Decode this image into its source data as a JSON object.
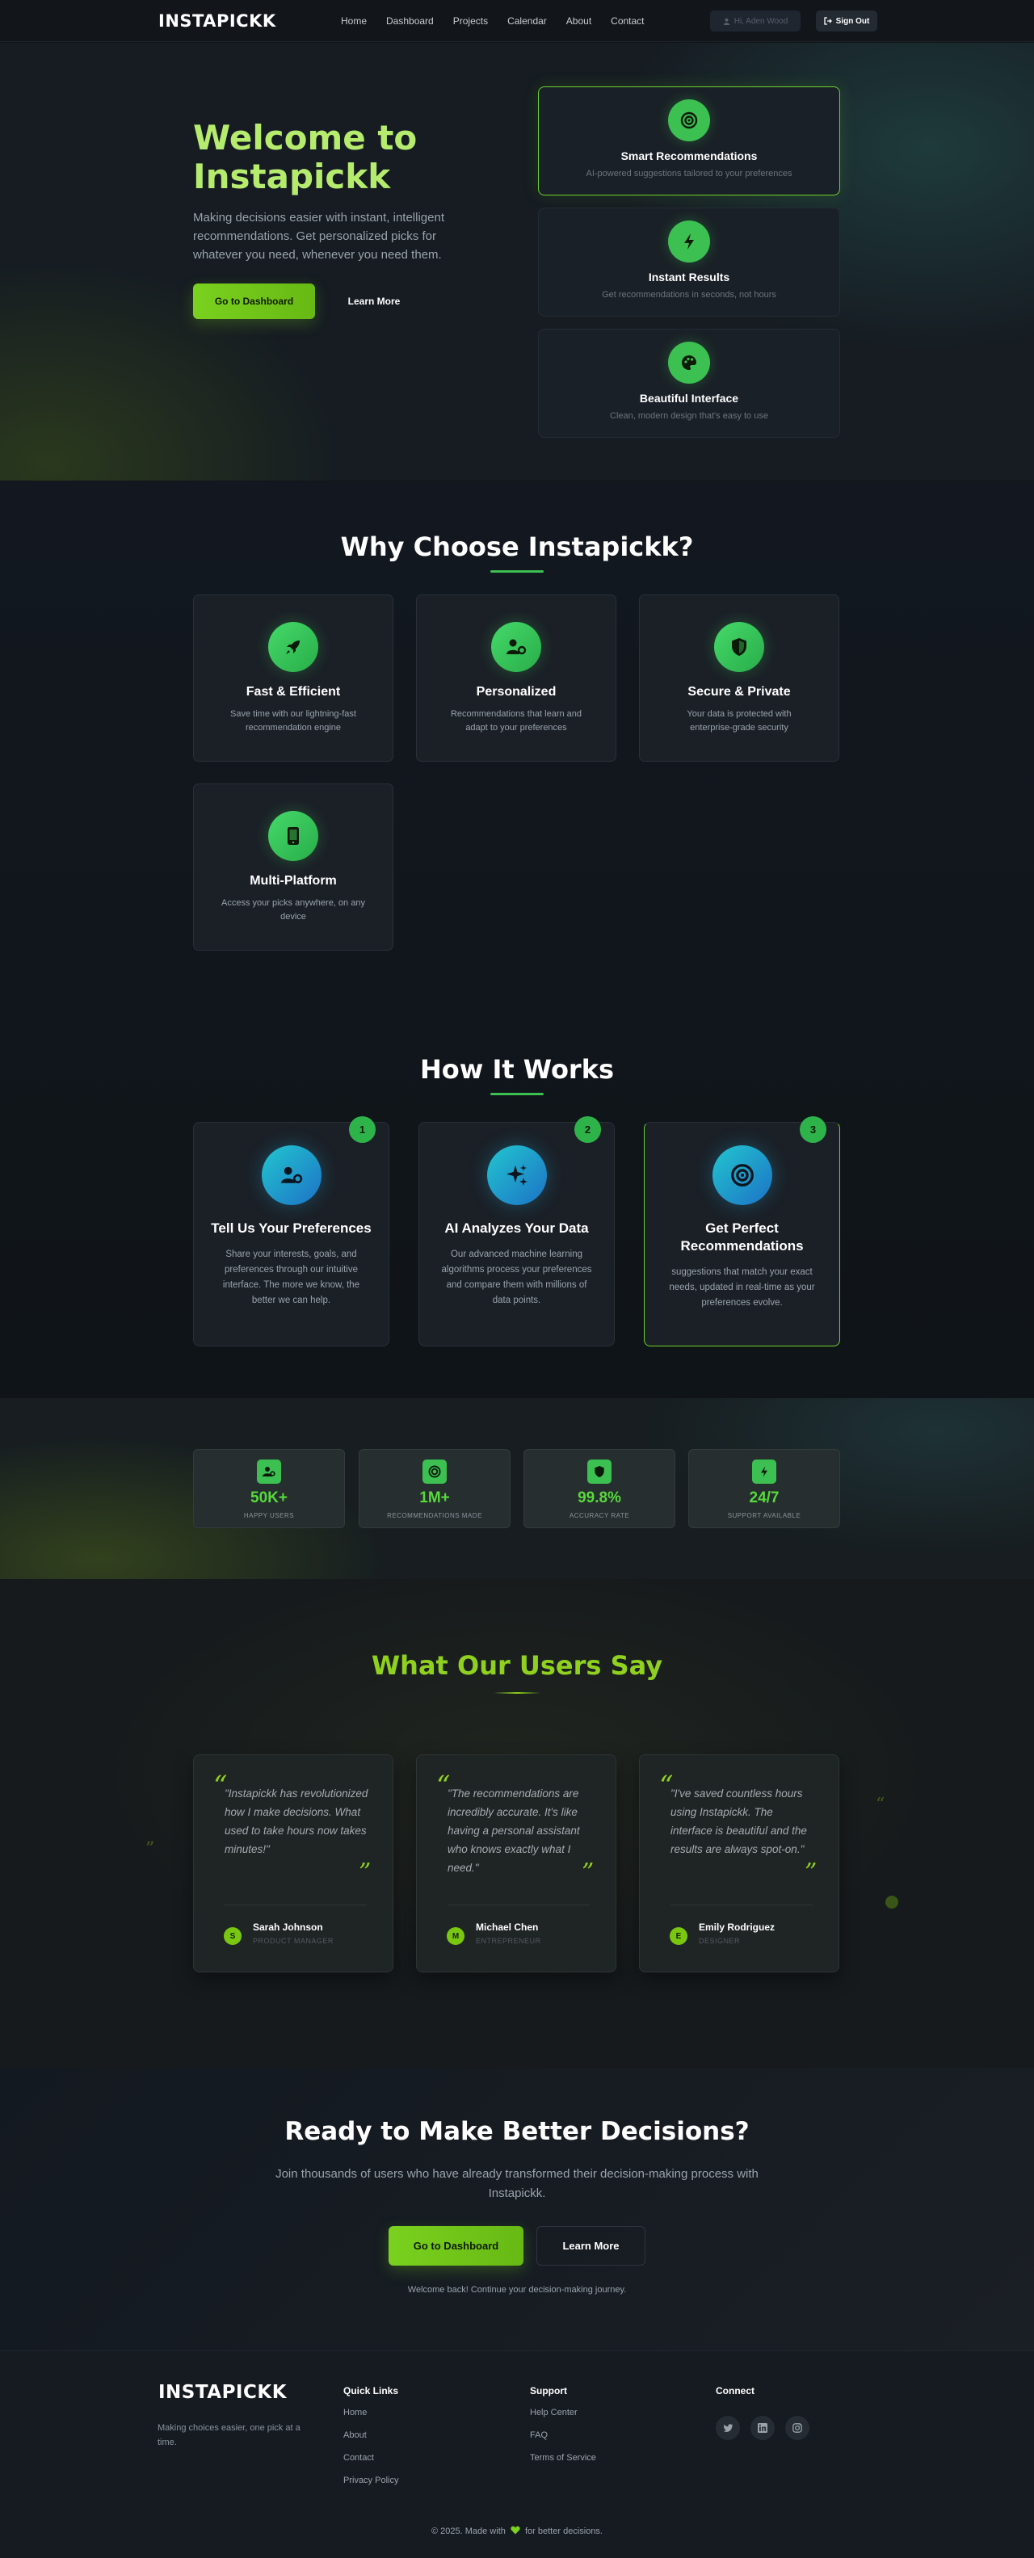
{
  "brand": {
    "name": "INSTAPICKK",
    "accent": "#7ad11e",
    "green": "#3cc052",
    "blue": "#1d72c6"
  },
  "nav": {
    "links": [
      "Home",
      "Dashboard",
      "Projects",
      "Calendar",
      "About",
      "Contact"
    ],
    "user": "Hi, Aden Wood",
    "signout": "Sign Out"
  },
  "hero": {
    "title": "Welcome to Instapickk",
    "subtitle": "Making decisions easier with instant, intelligent recommendations. Get personalized picks for whatever you need, whenever you need them.",
    "primary_button": "Go to Dashboard",
    "secondary_button": "Learn More",
    "features": [
      {
        "icon": "target-icon",
        "title": "Smart Recommendations",
        "desc": "AI-powered suggestions tailored to your preferences"
      },
      {
        "icon": "bolt-icon",
        "title": "Instant Results",
        "desc": "Get recommendations in seconds, not hours"
      },
      {
        "icon": "palette-icon",
        "title": "Beautiful Interface",
        "desc": "Clean, modern design that's easy to use"
      }
    ]
  },
  "why": {
    "title": "Why Choose Instapickk?",
    "cards": [
      {
        "icon": "rocket-icon",
        "title": "Fast & Efficient",
        "desc": "Save time with our lightning-fast recommendation engine"
      },
      {
        "icon": "user-gear-icon",
        "title": "Personalized",
        "desc": "Recommendations that learn and adapt to your preferences"
      },
      {
        "icon": "shield-icon",
        "title": "Secure & Private",
        "desc": "Your data is protected with enterprise-grade security"
      },
      {
        "icon": "mobile-icon",
        "title": "Multi-Platform",
        "desc": "Access your picks anywhere, on any device"
      }
    ]
  },
  "how": {
    "title": "How It Works",
    "steps": [
      {
        "num": "1",
        "icon": "user-gear-icon",
        "title": "Tell Us Your Preferences",
        "desc": "Share your interests, goals, and preferences through our intuitive interface. The more we know, the better we can help."
      },
      {
        "num": "2",
        "icon": "sparkles-icon",
        "title": "AI Analyzes Your Data",
        "desc": "Our advanced machine learning algorithms process your preferences and compare them with millions of data points."
      },
      {
        "num": "3",
        "icon": "target-icon",
        "title": "Get Perfect Recommendations",
        "desc": "suggestions that match your exact needs, updated in real-time as your preferences evolve."
      }
    ]
  },
  "stats": [
    {
      "icon": "users-icon",
      "value": "50K+",
      "label": "HAPPY USERS"
    },
    {
      "icon": "target-icon",
      "value": "1M+",
      "label": "RECOMMENDATIONS MADE"
    },
    {
      "icon": "shield-icon",
      "value": "99.8%",
      "label": "ACCURACY RATE"
    },
    {
      "icon": "bolt-icon",
      "value": "24/7",
      "label": "SUPPORT AVAILABLE"
    }
  ],
  "testimonials": {
    "title": "What Our Users Say",
    "items": [
      {
        "text": "Instapickk has revolutionized how I make decisions. What used to take hours now takes minutes!",
        "name": "Sarah Johnson",
        "role": "PRODUCT MANAGER",
        "initial": "S"
      },
      {
        "text": "The recommendations are incredibly accurate. It's like having a personal assistant who knows exactly what I need.",
        "name": "Michael Chen",
        "role": "ENTREPRENEUR",
        "initial": "M"
      },
      {
        "text": "I've saved countless hours using Instapickk. The interface is beautiful and the results are always spot-on.",
        "name": "Emily Rodriguez",
        "role": "DESIGNER",
        "initial": "E"
      }
    ]
  },
  "cta": {
    "title": "Ready to Make Better Decisions?",
    "subtitle": "Join thousands of users who have already transformed their decision-making process with Instapickk.",
    "primary_button": "Go to Dashboard",
    "secondary_button": "Learn More",
    "note": "Welcome back! Continue your decision-making journey."
  },
  "footer": {
    "logo": "INSTAPICKK",
    "tagline": "Making choices easier, one pick at a time.",
    "quick_links_title": "Quick Links",
    "quick_links": [
      "Home",
      "About",
      "Contact",
      "Privacy Policy"
    ],
    "support_title": "Support",
    "support_links": [
      "Help Center",
      "FAQ",
      "Terms of Service"
    ],
    "connect_title": "Connect",
    "socials": [
      "twitter-icon",
      "linkedin-icon",
      "instagram-icon"
    ],
    "copyright_pre": "© 2025. Made with",
    "copyright_post": "for better decisions."
  }
}
